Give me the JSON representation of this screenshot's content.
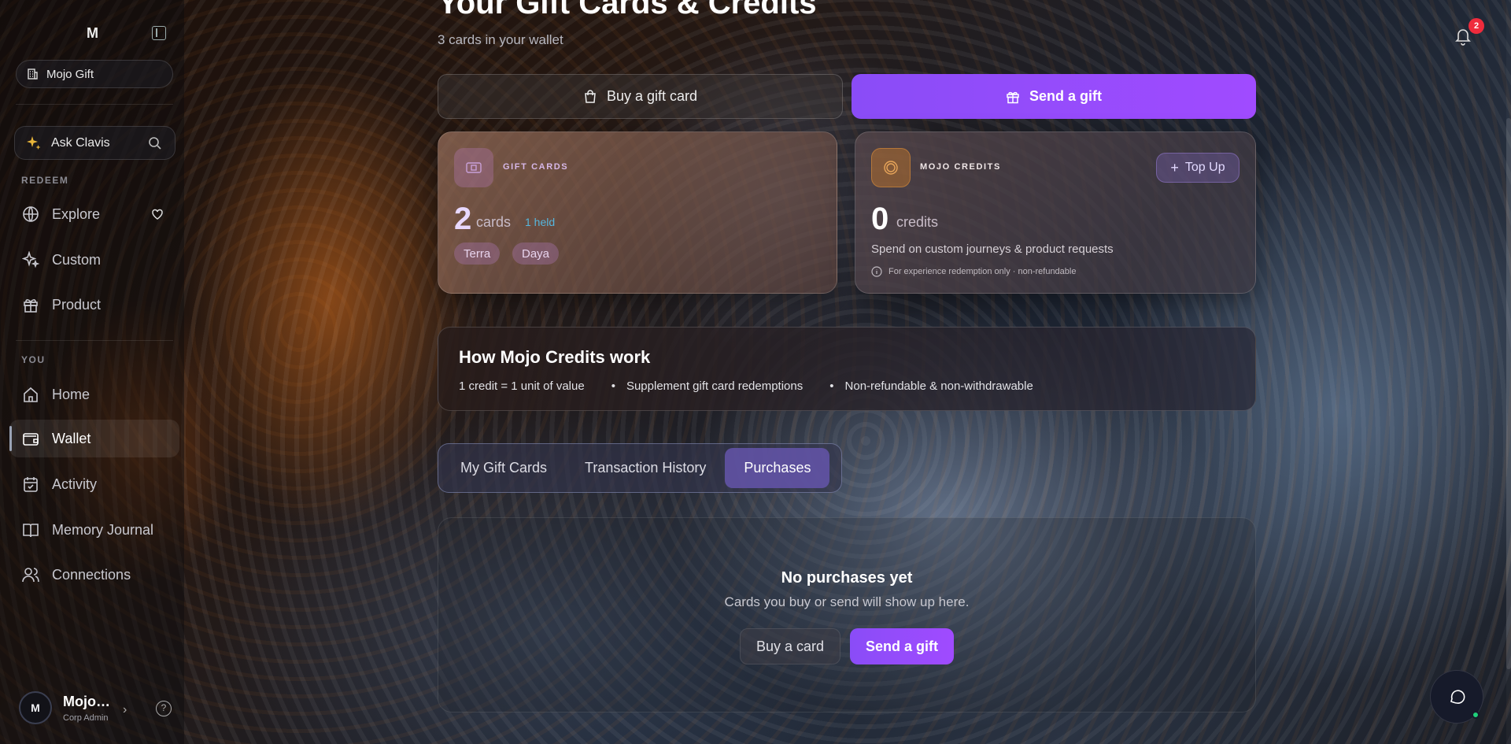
{
  "brand": {
    "logo_text": "M",
    "org_name": "Mojo Gift"
  },
  "sidebar": {
    "ask_label": "Ask Clavis",
    "section_redeem": "REDEEM",
    "section_you": "YOU",
    "redeem_items": [
      {
        "label": "Explore",
        "icon": "globe-icon"
      },
      {
        "label": "Custom",
        "icon": "sparkle-icon"
      },
      {
        "label": "Product",
        "icon": "gift-icon"
      }
    ],
    "you_items": [
      {
        "label": "Home",
        "icon": "home-icon"
      },
      {
        "label": "Wallet",
        "icon": "wallet-icon",
        "active": true
      },
      {
        "label": "Activity",
        "icon": "calendar-icon"
      },
      {
        "label": "Memory Journal",
        "icon": "book-icon"
      },
      {
        "label": "Connections",
        "icon": "users-icon"
      }
    ],
    "user": {
      "initial": "M",
      "name": "Mojo…",
      "role": "Corp Admin"
    }
  },
  "header": {
    "title": "Your Gift Cards & Credits",
    "subtitle": "3 cards in your wallet",
    "notification_count": "2"
  },
  "actions": {
    "buy_label": "Buy a gift card",
    "send_label": "Send a gift"
  },
  "gift_card": {
    "label": "GIFT CARDS",
    "count": "2",
    "unit": "cards",
    "held": "1 held",
    "chips": [
      "Terra",
      "Daya"
    ]
  },
  "credits_card": {
    "label": "MOJO CREDITS",
    "topup_label": "Top Up",
    "count": "0",
    "unit": "credits",
    "description": "Spend on custom journeys & product requests",
    "note": "For experience redemption only · non-refundable"
  },
  "how": {
    "title": "How Mojo Credits work",
    "points": [
      "1 credit = 1 unit of value",
      "Supplement gift card redemptions",
      "Non-refundable & non-withdrawable"
    ]
  },
  "tabs": [
    {
      "label": "My Gift Cards",
      "active": false
    },
    {
      "label": "Transaction History",
      "active": false
    },
    {
      "label": "Purchases",
      "active": true
    }
  ],
  "empty_state": {
    "title": "No purchases yet",
    "subtitle": "Cards you buy or send will show up here.",
    "buy_label": "Buy a card",
    "send_label": "Send a gift"
  },
  "colors": {
    "accent": "#9b4dff",
    "held": "#56b6dd",
    "badge": "#ef2b3c",
    "online": "#1fd07a"
  }
}
